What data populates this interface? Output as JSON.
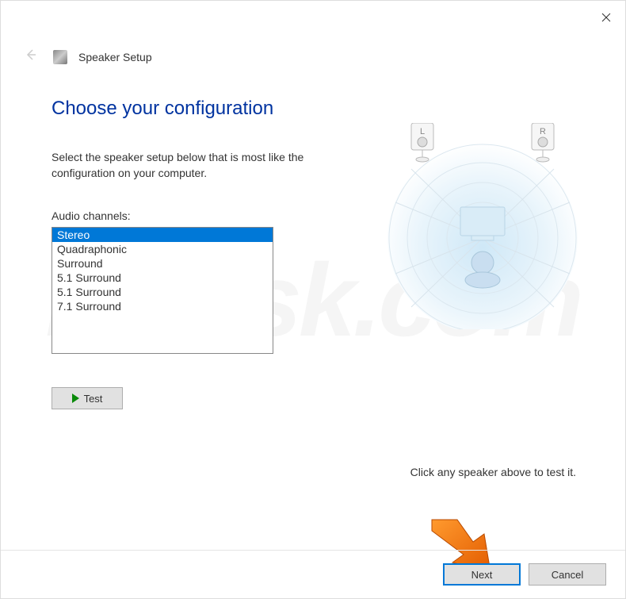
{
  "window": {
    "title": "Speaker Setup"
  },
  "page": {
    "heading": "Choose your configuration",
    "instruction": "Select the speaker setup below that is most like the configuration on your computer.",
    "channels_label": "Audio channels:",
    "test_label": "Test",
    "hint": "Click any speaker above to test it."
  },
  "channels": {
    "selected_index": 0,
    "items": [
      "Stereo",
      "Quadraphonic",
      "Surround",
      "5.1 Surround",
      "5.1 Surround",
      "7.1 Surround"
    ]
  },
  "footer": {
    "next": "Next",
    "cancel": "Cancel"
  },
  "diagram": {
    "left_speaker_label": "L",
    "right_speaker_label": "R"
  },
  "watermark": "PCrisk.com",
  "colors": {
    "accent": "#0078d7",
    "heading": "#0033a0"
  }
}
